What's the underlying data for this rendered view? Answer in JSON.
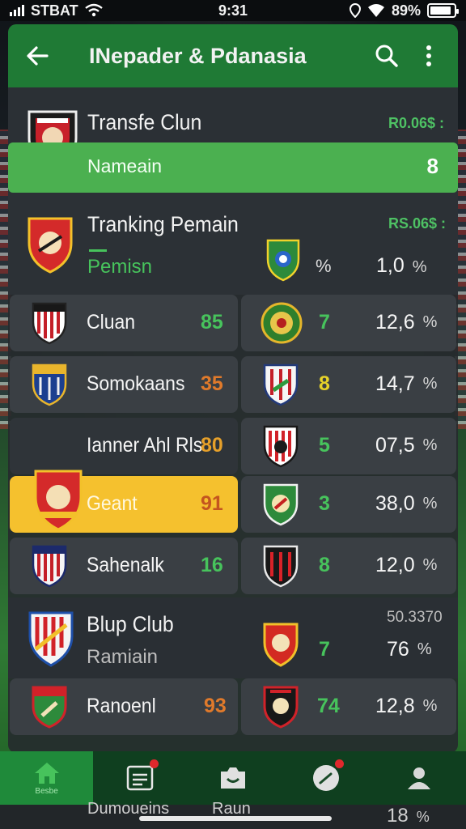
{
  "status_bar": {
    "carrier": "STBAT",
    "time": "9:31",
    "battery": "89%"
  },
  "app_bar": {
    "title": "INepader & Pdanasia"
  },
  "transfer": {
    "title": "Transfe Clun",
    "value": "R0.06$ :",
    "sub_label": "Nameain",
    "sub_count": "8"
  },
  "ranking": {
    "title": "Tranking Pemain",
    "value": "RS.06$ :",
    "sub_label": "Pemisn",
    "pct": "1,0",
    "pct_unit": "%",
    "pct_mark": "%"
  },
  "rows": [
    {
      "name": "Cluan",
      "count": "85",
      "count_color": "#47c35c",
      "rank": "7",
      "rank_color": "#47c35c",
      "pct": "12,6",
      "unit": "%"
    },
    {
      "name": "Somokaans",
      "count": "35",
      "count_color": "#e07a2b",
      "rank": "8",
      "rank_color": "#e6d229",
      "pct": "14,7",
      "unit": "%"
    },
    {
      "name": "Ianner Ahl Rls",
      "count": "80",
      "count_color": "#e6a02a",
      "rank": "5",
      "rank_color": "#47c35c",
      "pct": "07,5",
      "unit": "%"
    },
    {
      "name": "Geant",
      "count": "91",
      "count_color": "#c4551f",
      "rank": "3",
      "rank_color": "#47c35c",
      "pct": "38,0",
      "unit": "%"
    },
    {
      "name": "Sahenalk",
      "count": "16",
      "count_color": "#47c35c",
      "rank": "8",
      "rank_color": "#47c35c",
      "pct": "12,0",
      "unit": "%"
    }
  ],
  "blup": {
    "title": "Blup Club",
    "sub_label": "Ramiain",
    "value": "50.3370",
    "rank": "7",
    "pct": "76",
    "unit": "%"
  },
  "last_row": {
    "name": "Ranoenl",
    "count": "93",
    "count_color": "#e07a2b",
    "rank": "74",
    "rank_color": "#47c35c",
    "pct": "12,8",
    "unit": "%"
  },
  "footer_peek": {
    "left": "Dumoueins",
    "mid": "Raun",
    "right": "18",
    "unit": "%"
  },
  "nav": {
    "items": [
      {
        "label": "Besbe"
      },
      {
        "label": ""
      },
      {
        "label": ""
      },
      {
        "label": ""
      },
      {
        "label": ""
      }
    ]
  },
  "colors": {
    "green": "#1f7a35",
    "accent_green": "#47c35c",
    "highlight_yellow": "#f5c12e"
  }
}
